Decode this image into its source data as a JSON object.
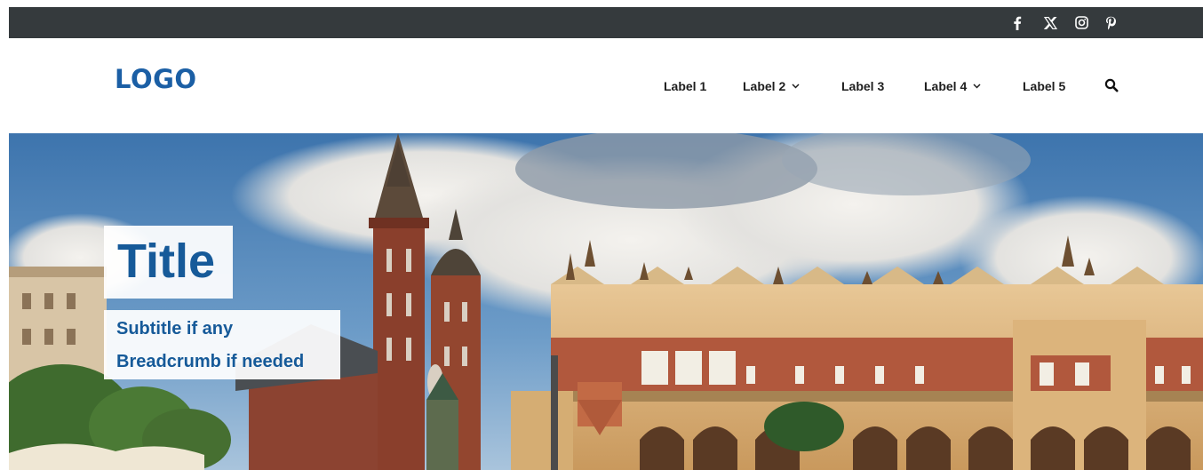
{
  "topbar": {
    "social": [
      {
        "icon": "facebook-icon",
        "name": "facebook"
      },
      {
        "icon": "x-twitter-icon",
        "name": "x"
      },
      {
        "icon": "instagram-icon",
        "name": "instagram"
      },
      {
        "icon": "pinterest-icon",
        "name": "pinterest"
      }
    ]
  },
  "header": {
    "logo": "LOGO",
    "nav": [
      {
        "label": "Label 1",
        "has_dropdown": false
      },
      {
        "label": "Label 2",
        "has_dropdown": true
      },
      {
        "label": "Label 3",
        "has_dropdown": false
      },
      {
        "label": "Label 4",
        "has_dropdown": true
      },
      {
        "label": "Label 5",
        "has_dropdown": false
      }
    ],
    "search_icon": "search-icon"
  },
  "hero": {
    "title": "Title",
    "subtitle": "Subtitle if any",
    "breadcrumb": "Breadcrumb if needed"
  },
  "colors": {
    "topbar_bg": "#353a3d",
    "brand_blue": "#1b5fa5",
    "nav_text": "#1e1e1e",
    "sky": "#4f82b6"
  }
}
